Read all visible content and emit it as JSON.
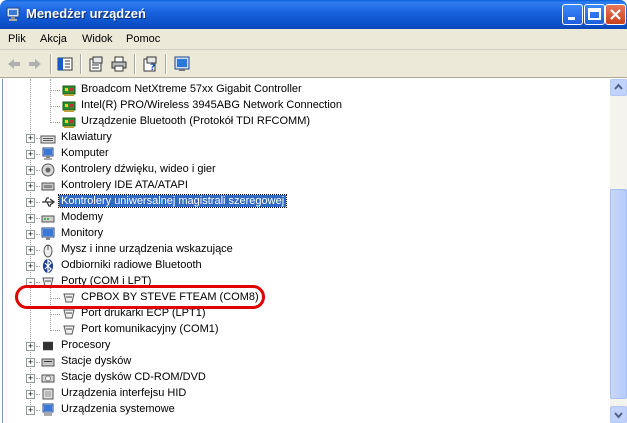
{
  "window": {
    "title": "Menedżer urządzeń"
  },
  "menu": {
    "items": [
      "Plik",
      "Akcja",
      "Widok",
      "Pomoc"
    ]
  },
  "tree": {
    "nodes": [
      {
        "label": "Broadcom NetXtreme 57xx Gigabit Controller",
        "icon": "network-card-icon",
        "child": true
      },
      {
        "label": "Intel(R) PRO/Wireless 3945ABG Network Connection",
        "icon": "network-card-icon",
        "child": true
      },
      {
        "label": "Urządzenie Bluetooth (Protokół TDI RFCOMM)",
        "icon": "network-card-icon",
        "child": true
      },
      {
        "label": "Klawiatury",
        "icon": "keyboard-icon",
        "expander": "+"
      },
      {
        "label": "Komputer",
        "icon": "computer-icon",
        "expander": "+"
      },
      {
        "label": "Kontrolery dźwięku, wideo i gier",
        "icon": "speaker-icon",
        "expander": "+"
      },
      {
        "label": "Kontrolery IDE ATA/ATAPI",
        "icon": "ide-controller-icon",
        "expander": "+"
      },
      {
        "label": "Kontrolery uniwersalnej magistrali szeregowej",
        "icon": "usb-icon",
        "expander": "+",
        "selected": true
      },
      {
        "label": "Modemy",
        "icon": "modem-icon",
        "expander": "+"
      },
      {
        "label": "Monitory",
        "icon": "monitor-icon",
        "expander": "+"
      },
      {
        "label": "Mysz i inne urządzenia wskazujące",
        "icon": "mouse-icon",
        "expander": "+"
      },
      {
        "label": "Odbiorniki radiowe Bluetooth",
        "icon": "bluetooth-icon",
        "expander": "+"
      },
      {
        "label": "Porty (COM i LPT)",
        "icon": "port-icon",
        "expander": "-"
      },
      {
        "label": "CPBOX BY STEVE FTEAM (COM8)",
        "icon": "port-icon",
        "child": true
      },
      {
        "label": "Port drukarki ECP (LPT1)",
        "icon": "port-icon",
        "child": true
      },
      {
        "label": "Port komunikacyjny (COM1)",
        "icon": "port-icon",
        "child": true
      },
      {
        "label": "Procesory",
        "icon": "processor-icon",
        "expander": "+"
      },
      {
        "label": "Stacje dysków",
        "icon": "disk-drive-icon",
        "expander": "+"
      },
      {
        "label": "Stacje dysków CD-ROM/DVD",
        "icon": "cdrom-icon",
        "expander": "+"
      },
      {
        "label": "Urządzenia interfejsu HID",
        "icon": "hid-icon",
        "expander": "+"
      },
      {
        "label": "Urządzenia systemowe",
        "icon": "system-devices-icon",
        "expander": "+"
      }
    ]
  },
  "colors": {
    "selection": "#316ac5",
    "highlight_ellipse": "#e00000",
    "titlebar": "#0a4fc8"
  }
}
